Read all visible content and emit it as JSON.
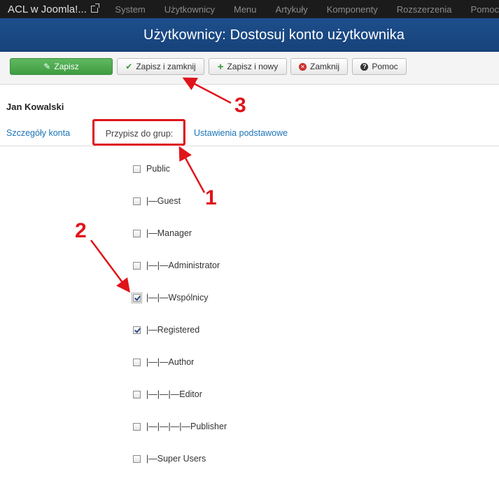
{
  "navbar": {
    "brand": "ACL w Joomla!...",
    "items": [
      "System",
      "Użytkownicy",
      "Menu",
      "Artykuły",
      "Komponenty",
      "Rozszerzenia",
      "Pomoc"
    ]
  },
  "header": {
    "title": "Użytkownicy: Dostosuj konto użytkownika"
  },
  "toolbar": {
    "save": "Zapisz",
    "save_close": "Zapisz i zamknij",
    "save_new": "Zapisz i nowy",
    "close": "Zamknij",
    "help": "Pomoc"
  },
  "user": {
    "name": "Jan Kowalski"
  },
  "tabs": {
    "details": "Szczegóły konta",
    "groups": "Przypisz do grup:",
    "basic": "Ustawienia podstawowe",
    "active": "groups"
  },
  "groups": [
    {
      "label": "Public",
      "checked": false
    },
    {
      "label": "|—Guest",
      "checked": false
    },
    {
      "label": "|—Manager",
      "checked": false
    },
    {
      "label": "|—|—Administrator",
      "checked": false
    },
    {
      "label": "|—|—Wspólnicy",
      "checked": true,
      "focused": true
    },
    {
      "label": "|—Registered",
      "checked": true
    },
    {
      "label": "|—|—Author",
      "checked": false
    },
    {
      "label": "|—|—|—Editor",
      "checked": false
    },
    {
      "label": "|—|—|—|—Publisher",
      "checked": false
    },
    {
      "label": "|—Super Users",
      "checked": false
    }
  ],
  "annotations": {
    "n1": "1",
    "n2": "2",
    "n3": "3",
    "color": "#e0141b"
  }
}
